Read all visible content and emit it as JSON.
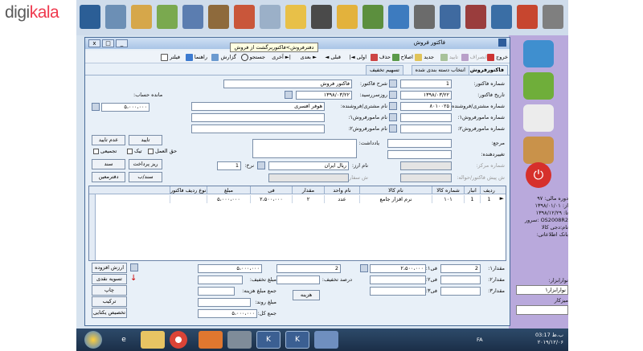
{
  "brand": {
    "part1": "digi",
    "part2": "kala"
  },
  "window": {
    "title": "فاکتور فروش",
    "tooltip": "دفترفروش>فاکتوربرگشت از فروش",
    "controls": {
      "min": "_",
      "max": "□",
      "close": "x"
    }
  },
  "toolbar": {
    "items": [
      "خروج",
      "انصراف",
      "تایید",
      "جدید",
      "اصلاح",
      "حذف",
      "اولی",
      "قبلی",
      "بعدی",
      "آخری",
      "جستجو",
      "گزارش",
      "راهنما",
      "فیلتر"
    ]
  },
  "tabs": [
    "فاکتورفروش",
    "انتخاب دسته بندی شده",
    "تسهیم تخفیف"
  ],
  "form": {
    "invoice_no_label": "شماره فاکتور:",
    "invoice_no": "1",
    "invoice_date_label": "تاریخ فاکتور:",
    "invoice_date": "۱۳۹۸/۰۳/۲۲",
    "customer_no_label": "شماره مشتری/فروشنده:",
    "customer_no": "۸۰۱۰۰۲۵",
    "agent1_label": "شماره مامورفروش۱:",
    "agent2_label": "شماره مامورفروش۲:",
    "ref_label": "مرجع:",
    "changer_label": "تغییردهنده:",
    "center_no_label": "شماره مرکز:",
    "preinvoice_label": "ش پیش فاکتور/حواله:",
    "desc_label": "شرح فاکتور:",
    "desc": "فاکتور فروش",
    "due_label": "روزسررسید:",
    "due": "۱۳۹۸/۰۳/۲۲",
    "customer_name_label": "نام مشتری/فروشنده:",
    "customer_name": "هوفر افسری",
    "agent1_name_label": "نام مامورفروش۱:",
    "agent2_name_label": "نام مامورفروش۲:",
    "notes_label": "یادداشت:",
    "currency_label": "نام ارز:",
    "currency": "ریال ایران",
    "rate_label": "نرخ:",
    "rate": "1",
    "order_label": "ش سفارش:",
    "balance_label": "مانده حساب:",
    "balance": "۵،۰۰۰،۰۰۰"
  },
  "buttons": {
    "reject": "عدم تایید",
    "approve": "تایید",
    "receive_pay": "ریز پرداخت",
    "doc": "سند",
    "book": "دفترمعین",
    "doc_ba": "سند/ب",
    "added_value": "ارزش افزوده",
    "settle": "تسویه نقدی",
    "print": "چاپ",
    "combine": "ترکیب",
    "electronic": "تخصیص یکتایی",
    "cost": "هزینه"
  },
  "checks": {
    "commission": "حق العمل",
    "tick": "تیک",
    "group": "تجمیعی"
  },
  "grid": {
    "headers": [
      "ردیف",
      "انبار",
      "شماره کالا",
      "نام کالا",
      "نام واحد",
      "مقدار",
      "فی",
      "مبلغ",
      "ام نوع ردیف فاکتور"
    ],
    "rows": [
      [
        "1",
        "1",
        "۱۰۱",
        "نرم افزار جامع",
        "عدد",
        "۲",
        "۲،۵۰۰،۰۰۰",
        "۵،۰۰۰،۰۰۰",
        ""
      ]
    ]
  },
  "summary": {
    "qty1_label": "مقدار۱:",
    "qty1": "2",
    "fee1_label": "فی۱:",
    "fee1": "۲،۵۰۰،۰۰۰",
    "qty2_label": "مقدار۲:",
    "fee2_label": "فی۲:",
    "qty3_label": "مقدار۳:",
    "fee3_label": "فی۳:",
    "qty_total": "2",
    "discount_pct_label": "درصد تخفیف:",
    "amount": "۵،۰۰۰،۰۰۰",
    "discount_amount_label": "مبلغ تخفیف:",
    "cost_total_label": "جمع مبلغ هزینه:",
    "round_label": "مبلغ روند:",
    "total_label": "جمع کل:",
    "total": "۵،۰۰۰،۰۰۰"
  },
  "right_panel": {
    "info": [
      "دوره مالی: ۹۷",
      "از: ۱۳۹۸/۰۱/۰۱",
      "تا: ۱۳۹۸/۱۲/۲۹",
      "",
      "OS2008R2 :سرور",
      "نام:دجی کالا",
      "بانک اطلاعاتی:"
    ],
    "box1": "۹۷",
    "currency_label": "نوارابزار:",
    "currency_val": "نوارابزار۱",
    "desk_label": "میزکار"
  },
  "taskbar": {
    "lang": "FA",
    "time": "03:17 ب.ظ",
    "date": "۲۰۱۹/۱۲/۰۶"
  }
}
